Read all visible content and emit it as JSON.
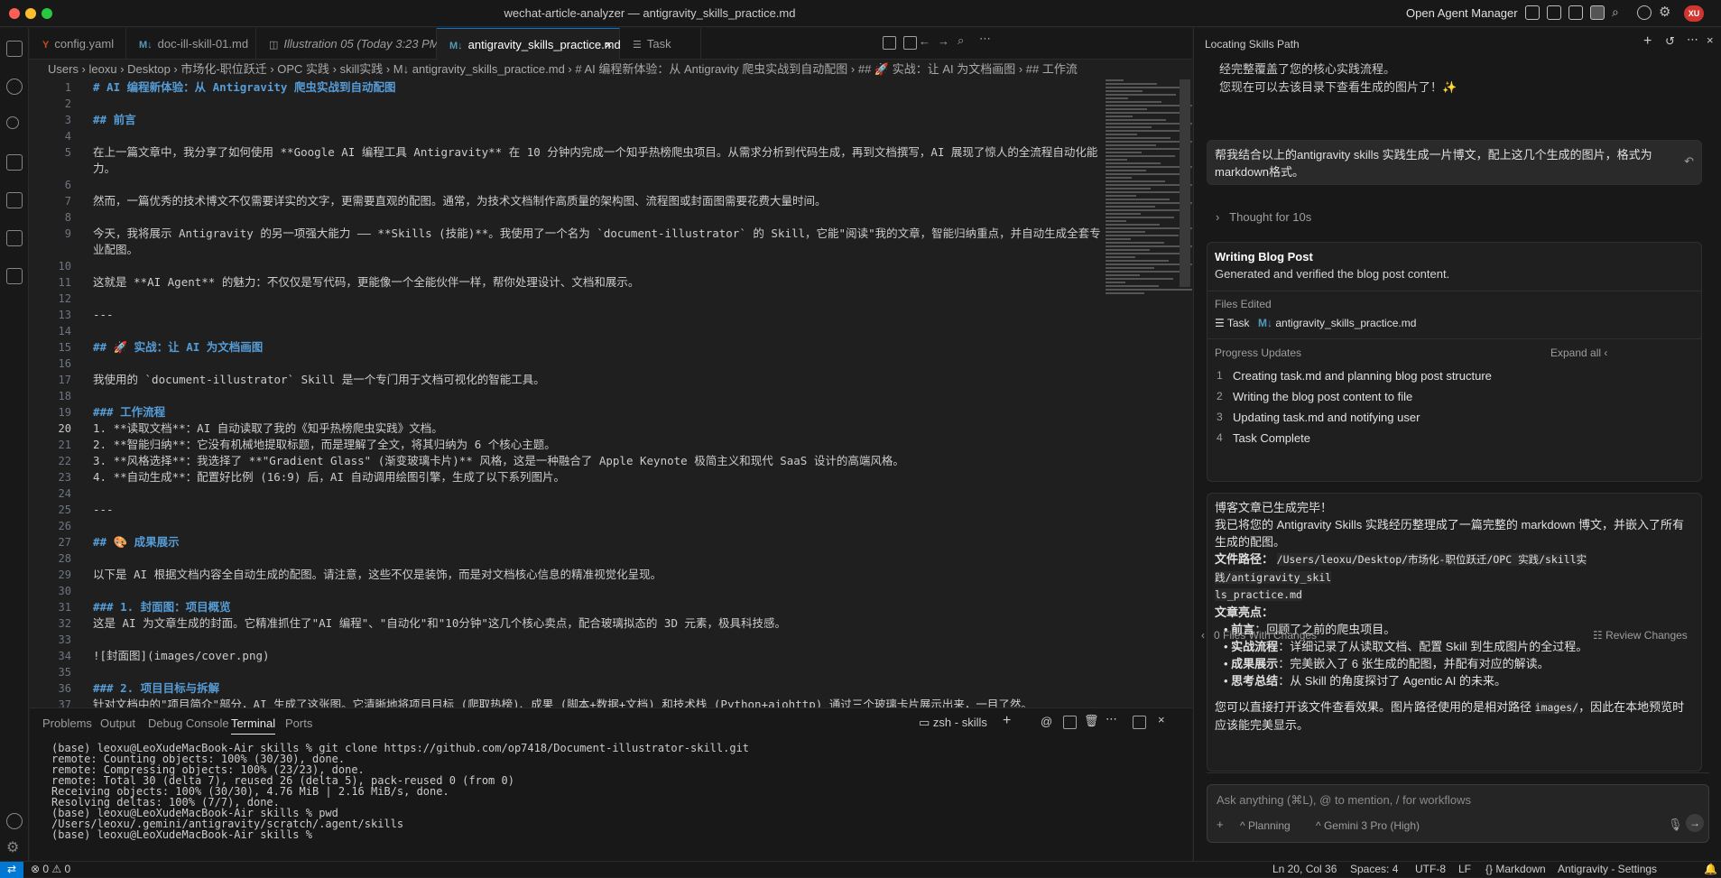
{
  "window": {
    "title": "wechat-article-analyzer — antigravity_skills_practice.md",
    "agent_manager": "Open Agent Manager",
    "avatar": "XU"
  },
  "tabs": [
    {
      "icon": "Y",
      "label": "config.yaml"
    },
    {
      "icon": "M↓",
      "label": "doc-ill-skill-01.md"
    },
    {
      "icon": "",
      "label": "Illustration 05 (Today 3:23 PM)"
    },
    {
      "icon": "M↓",
      "label": "antigravity_skills_practice.md"
    },
    {
      "icon": "",
      "label": "Task"
    }
  ],
  "breadcrumb": "Users  ›  leoxu  ›  Desktop  ›  市场化-职位跃迁  ›  OPC 实践  ›  skill实践  ›  M↓ antigravity_skills_practice.md  ›  # AI 编程新体验：从 Antigravity 爬虫实战到自动配图  ›  ## 🚀 实战：让 AI 为文档画图  ›  ## 工作流",
  "editor": {
    "lines": [
      {
        "n": "1",
        "t": "# AI 编程新体验：从 Antigravity 爬虫实战到自动配图",
        "h": true
      },
      {
        "n": "2",
        "t": ""
      },
      {
        "n": "3",
        "t": "## 前言",
        "h": true
      },
      {
        "n": "4",
        "t": ""
      },
      {
        "n": "5",
        "t": "在上一篇文章中，我分享了如何使用 **Google AI 编程工具 Antigravity** 在 10 分钟内完成一个知乎热榜爬虫项目。从需求分析到代码生成，再到文档撰写，AI 展现了惊人的全流程自动化能"
      },
      {
        "n": "",
        "t": "力。"
      },
      {
        "n": "6",
        "t": ""
      },
      {
        "n": "7",
        "t": "然而，一篇优秀的技术博文不仅需要详实的文字，更需要直观的配图。通常，为技术文档制作高质量的架构图、流程图或封面图需要花费大量时间。"
      },
      {
        "n": "8",
        "t": ""
      },
      {
        "n": "9",
        "t": "今天，我将展示 Antigravity 的另一项强大能力 —— **Skills (技能)**。我使用了一个名为 `document-illustrator` 的 Skill，它能\"阅读\"我的文章，智能归纳重点，并自动生成全套专"
      },
      {
        "n": "",
        "t": "业配图。"
      },
      {
        "n": "10",
        "t": ""
      },
      {
        "n": "11",
        "t": "这就是 **AI Agent** 的魅力：不仅仅是写代码，更能像一个全能伙伴一样，帮你处理设计、文档和展示。"
      },
      {
        "n": "12",
        "t": ""
      },
      {
        "n": "13",
        "t": "---"
      },
      {
        "n": "14",
        "t": ""
      },
      {
        "n": "15",
        "t": "## 🚀 实战：让 AI 为文档画图",
        "h": true
      },
      {
        "n": "16",
        "t": ""
      },
      {
        "n": "17",
        "t": "我使用的 `document-illustrator` Skill 是一个专门用于文档可视化的智能工具。"
      },
      {
        "n": "18",
        "t": ""
      },
      {
        "n": "19",
        "t": "### 工作流程",
        "h": true
      },
      {
        "n": "20",
        "t": "1. **读取文档**：AI 自动读取了我的《知乎热榜爬虫实践》文档。",
        "cur": true
      },
      {
        "n": "21",
        "t": "2. **智能归纳**：它没有机械地提取标题，而是理解了全文，将其归纳为 6 个核心主题。"
      },
      {
        "n": "22",
        "t": "3. **风格选择**：我选择了 **\"Gradient Glass\" (渐变玻璃卡片)** 风格，这是一种融合了 Apple Keynote 极简主义和现代 SaaS 设计的高端风格。"
      },
      {
        "n": "23",
        "t": "4. **自动生成**：配置好比例 (16:9) 后，AI 自动调用绘图引擎，生成了以下系列图片。"
      },
      {
        "n": "24",
        "t": ""
      },
      {
        "n": "25",
        "t": "---"
      },
      {
        "n": "26",
        "t": ""
      },
      {
        "n": "27",
        "t": "## 🎨 成果展示",
        "h": true
      },
      {
        "n": "28",
        "t": ""
      },
      {
        "n": "29",
        "t": "以下是 AI 根据文档内容全自动生成的配图。请注意，这些不仅是装饰，而是对文档核心信息的精准视觉化呈现。"
      },
      {
        "n": "30",
        "t": ""
      },
      {
        "n": "31",
        "t": "### 1. 封面图：项目概览",
        "h": true
      },
      {
        "n": "32",
        "t": "这是 AI 为文章生成的封面。它精准抓住了\"AI 编程\"、\"自动化\"和\"10分钟\"这几个核心卖点，配合玻璃拟态的 3D 元素，极具科技感。"
      },
      {
        "n": "33",
        "t": ""
      },
      {
        "n": "34",
        "t": "![封面图](images/cover.png)"
      },
      {
        "n": "35",
        "t": ""
      },
      {
        "n": "36",
        "t": "### 2. 项目目标与拆解",
        "h": true
      },
      {
        "n": "37",
        "t": "针对文档中的\"项目简介\"部分，AI 生成了这张图。它清晰地将项目目标 (爬取热榜)、成果 (脚本+数据+文档) 和技术栈 (Python+aiohttp) 通过三个玻璃卡片展示出来，一目了然。"
      }
    ]
  },
  "panel": {
    "tabs": [
      "Problems",
      "Output",
      "Debug Console",
      "Terminal",
      "Ports"
    ],
    "active_tab": "Terminal",
    "terminal_name": "zsh - skills",
    "terminal_lines": [
      "(base) leoxu@LeoXudeMacBook-Air skills % git clone https://github.com/op7418/Document-illustrator-skill.git",
      "remote: Counting objects: 100% (30/30), done.",
      "remote: Compressing objects: 100% (23/23), done.",
      "remote: Total 30 (delta 7), reused 26 (delta 5), pack-reused 0 (from 0)",
      "Receiving objects: 100% (30/30), 4.76 MiB | 2.16 MiB/s, done.",
      "Resolving deltas: 100% (7/7), done.",
      "(base) leoxu@LeoXudeMacBook-Air skills % pwd",
      "/Users/leoxu/.gemini/antigravity/scratch/.agent/skills",
      "(base) leoxu@LeoXudeMacBook-Air skills % "
    ]
  },
  "chat": {
    "title": "Locating Skills Path",
    "prev_text_1": "经完整覆盖了您的核心实践流程。",
    "prev_text_2": "您现在可以去该目录下查看生成的图片了！✨",
    "user_msg": "帮我结合以上的antigravity skills 实践生成一片博文，配上这几个生成的图片，格式为markdown格式。",
    "thought": "Thought for 10s",
    "card_title": "Writing Blog Post",
    "card_sub": "Generated and verified the blog post content.",
    "files_edited_label": "Files Edited",
    "file_task": "Task",
    "file_md": "antigravity_skills_practice.md",
    "progress_label": "Progress Updates",
    "expand_all": "Expand all",
    "progress": [
      {
        "n": "1",
        "t": "Creating task.md and planning blog post structure"
      },
      {
        "n": "2",
        "t": "Writing the blog post content to file"
      },
      {
        "n": "3",
        "t": "Updating task.md and notifying user"
      },
      {
        "n": "4",
        "t": "Task Complete"
      }
    ],
    "final": {
      "l1": "博客文章已生成完毕！",
      "l2": "我已将您的 Antigravity Skills 实践经历整理成了一篇完整的 markdown 博文，并嵌入了所有",
      "l3": "生成的配图。",
      "path_label": "文件路径：",
      "path1": "/Users/leoxu/Desktop/市场化-职位跃迁/OPC 实践/skill实践/antigravity_skil",
      "path2": "ls_practice.md",
      "hl_label": "文章亮点：",
      "bullets": [
        {
          "b": "前言",
          "t": "：回顾了之前的爬虫项目。"
        },
        {
          "b": "实战流程",
          "t": "：详细记录了从读取文档、配置 Skill 到生成图片的全过程。"
        },
        {
          "b": "成果展示",
          "t": "：完美嵌入了 6 张生成的配图，并配有对应的解读。"
        },
        {
          "b": "思考总结",
          "t": "：从 Skill 的角度探讨了 Agentic AI 的未来。"
        }
      ],
      "e1": "您可以直接打开该文件查看效果。图片路径使用的是相对路径",
      "e1_code": "images/",
      "e1b": "，因此在本地预览时",
      "e2": "应该能完美显示。"
    },
    "files_changes": "0 Files With Changes",
    "review": "Review Changes",
    "input_placeholder": "Ask anything (⌘L), @ to mention, / for workflows",
    "mode": "Planning",
    "model": "Gemini 3 Pro (High)"
  },
  "status": {
    "errors": "0",
    "warnings": "0",
    "position": "Ln 20, Col 36",
    "spaces": "Spaces: 4",
    "encoding": "UTF-8",
    "eol": "LF",
    "language": "Markdown",
    "settings": "Antigravity - Settings"
  },
  "colors": {
    "accent": "#0078d4",
    "heading": "#569cd6",
    "avatar": "#d1352f"
  }
}
